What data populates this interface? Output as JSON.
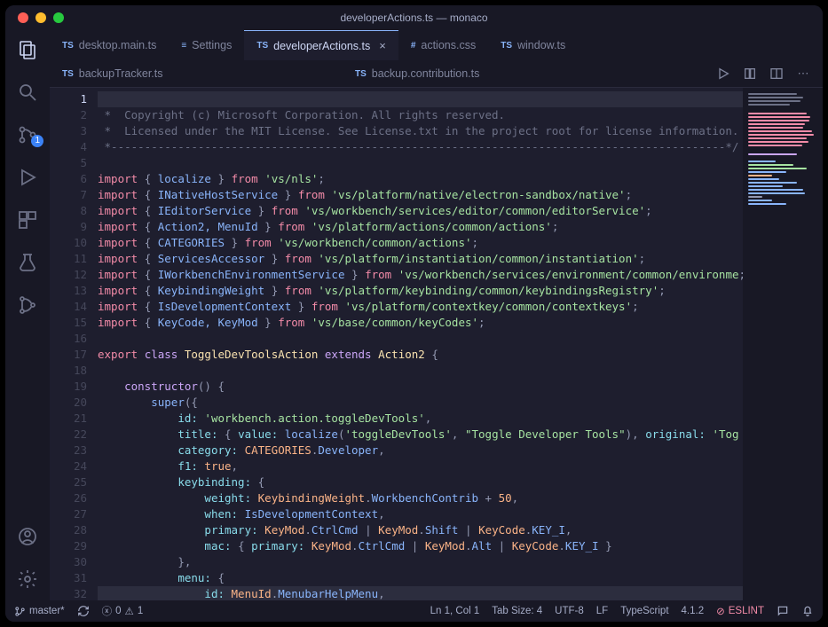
{
  "window": {
    "title": "developerActions.ts — monaco"
  },
  "tabs_row1": [
    {
      "prefix": "TS",
      "label": "desktop.main.ts",
      "active": false,
      "close": false
    },
    {
      "prefix": "≡",
      "label": "Settings",
      "active": false,
      "close": false
    },
    {
      "prefix": "TS",
      "label": "developerActions.ts",
      "active": true,
      "close": true
    },
    {
      "prefix": "#",
      "label": "actions.css",
      "active": false,
      "close": false
    },
    {
      "prefix": "TS",
      "label": "window.ts",
      "active": false,
      "close": false
    }
  ],
  "tabs_row2": [
    {
      "prefix": "TS",
      "label": "backupTracker.ts"
    },
    {
      "prefix": "TS",
      "label": "backup.contribution.ts"
    }
  ],
  "scm_badge": "1",
  "status": {
    "branch": "master*",
    "errors": "0",
    "warnings": "1",
    "position": "Ln 1, Col 1",
    "tabsize": "Tab Size: 4",
    "encoding": "UTF-8",
    "eol": "LF",
    "lang": "TypeScript",
    "tsver": "4.1.2",
    "eslint": "ESLINT"
  },
  "code": {
    "l2": " *  Copyright (c) Microsoft Corporation. All rights reserved.",
    "l3": " *  Licensed under the MIT License. See License.txt in the project root for license information.",
    "l4": " *--------------------------------------------------------------------------------------------*/",
    "imports": [
      {
        "items": "localize",
        "from": "'vs/nls'"
      },
      {
        "items": "INativeHostService",
        "from": "'vs/platform/native/electron-sandbox/native'"
      },
      {
        "items": "IEditorService",
        "from": "'vs/workbench/services/editor/common/editorService'"
      },
      {
        "items": "Action2, MenuId",
        "from": "'vs/platform/actions/common/actions'"
      },
      {
        "items": "CATEGORIES",
        "from": "'vs/workbench/common/actions'"
      },
      {
        "items": "ServicesAccessor",
        "from": "'vs/platform/instantiation/common/instantiation'"
      },
      {
        "items": "IWorkbenchEnvironmentService",
        "from": "'vs/workbench/services/environment/common/environme"
      },
      {
        "items": "KeybindingWeight",
        "from": "'vs/platform/keybinding/common/keybindingsRegistry'"
      },
      {
        "items": "IsDevelopmentContext",
        "from": "'vs/platform/contextkey/common/contextkeys'"
      },
      {
        "items": "KeyCode, KeyMod",
        "from": "'vs/base/common/keyCodes'"
      }
    ],
    "class": {
      "export": "export",
      "class_kw": "class",
      "name": "ToggleDevToolsAction",
      "extends_kw": "extends",
      "base": "Action2"
    },
    "ctor": {
      "id_key": "id:",
      "id_val": "'workbench.action.toggleDevTools'",
      "title_key": "title:",
      "value_key": "value:",
      "localize": "localize",
      "localize_arg1": "'toggleDevTools'",
      "localize_arg2": "\"Toggle Developer Tools\"",
      "original_key": "original:",
      "original_val": "'Tog",
      "category_key": "category:",
      "cat_enum": "CATEGORIES",
      "cat_prop": "Developer",
      "f1_key": "f1:",
      "f1_val": "true",
      "keybinding_key": "keybinding:",
      "weight_key": "weight:",
      "kb_enum": "KeybindingWeight",
      "kb_prop": "WorkbenchContrib",
      "plus50": "50",
      "when_key": "when:",
      "when_val": "IsDevelopmentContext",
      "primary_key": "primary:",
      "keymod": "KeyMod",
      "ctrlcmd": "CtrlCmd",
      "shift": "Shift",
      "alt": "Alt",
      "keycode": "KeyCode",
      "keyi": "KEY_I",
      "mac_key": "mac:",
      "menu_key": "menu:",
      "menuid": "MenuId",
      "menubar": "MenubarHelpMenu"
    }
  }
}
